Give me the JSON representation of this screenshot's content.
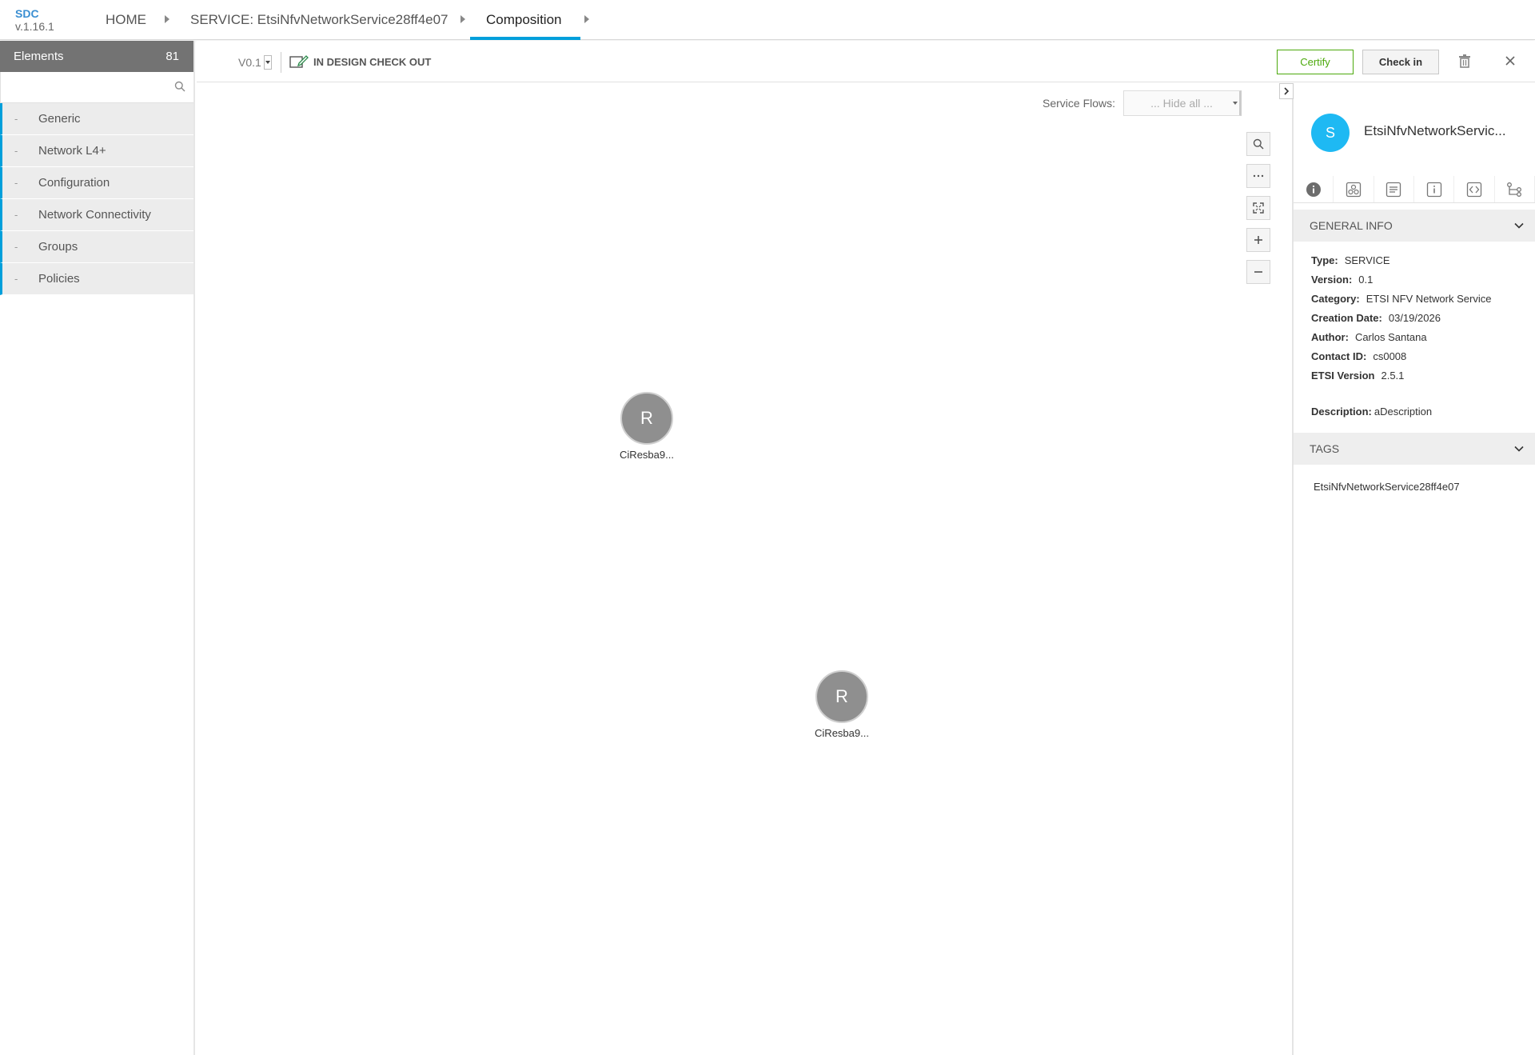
{
  "app": {
    "name": "SDC",
    "version": "v.1.16.1"
  },
  "breadcrumb": [
    {
      "label": "HOME"
    },
    {
      "label": "SERVICE: EtsiNfvNetworkService28ff4e07"
    },
    {
      "label": "Composition"
    }
  ],
  "left_panel": {
    "title": "Elements",
    "count": "81",
    "search": {
      "value": "",
      "placeholder": ""
    },
    "categories": [
      {
        "label": "Generic"
      },
      {
        "label": "Network L4+"
      },
      {
        "label": "Configuration"
      },
      {
        "label": "Network Connectivity"
      },
      {
        "label": "Groups"
      },
      {
        "label": "Policies"
      }
    ]
  },
  "toolbar": {
    "version": "V0.1",
    "status": "IN DESIGN CHECK OUT",
    "certify_label": "Certify",
    "checkin_label": "Check in"
  },
  "canvas": {
    "service_flows_label": "Service Flows:",
    "service_flows_value": "... Hide all ...",
    "nodes": [
      {
        "initial": "R",
        "label": "CiResba9..."
      },
      {
        "initial": "R",
        "label": "CiResba9..."
      }
    ]
  },
  "right_panel": {
    "avatar_letter": "S",
    "title": "EtsiNfvNetworkServic...",
    "general_info_title": "GENERAL INFO",
    "info": [
      {
        "key": "Type:",
        "value": "SERVICE"
      },
      {
        "key": "Version:",
        "value": "0.1"
      },
      {
        "key": "Category:",
        "value": "ETSI NFV Network Service"
      },
      {
        "key": "Creation Date:",
        "value": "03/19/2026"
      },
      {
        "key": "Author:",
        "value": "Carlos Santana"
      },
      {
        "key": "Contact ID:",
        "value": "cs0008"
      },
      {
        "key": "ETSI Version",
        "value": "2.5.1"
      }
    ],
    "description_key": "Description:",
    "description_value": "aDescription",
    "tags_title": "TAGS",
    "tags": [
      "EtsiNfvNetworkService28ff4e07"
    ]
  },
  "colors": {
    "accent": "#009fdb",
    "certify": "#4ca90c",
    "avatar": "#1eb9f3",
    "node": "#8f8f8f",
    "elements_header": "#737373"
  },
  "icons": [
    "search-icon",
    "edit-checkout-icon",
    "trash-icon",
    "close-icon",
    "zoom-search-icon",
    "more-icon",
    "fit-screen-icon",
    "zoom-in-icon",
    "zoom-out-icon",
    "collapse-arrow-icon",
    "info-tab-icon",
    "deployment-tab-icon",
    "properties-tab-icon",
    "details-tab-icon",
    "api-tab-icon",
    "relations-tab-icon",
    "chevron-down-icon"
  ]
}
